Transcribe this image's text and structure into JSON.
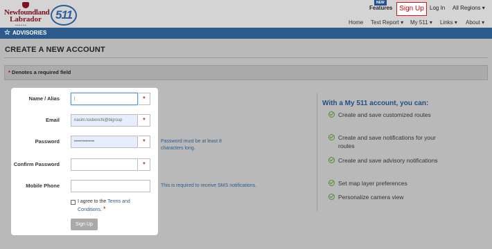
{
  "header": {
    "logo_line1": "Newfoundland",
    "logo_line2": "Labrador",
    "logo_511": "511",
    "new_badge": "NEW",
    "features": "Features",
    "sign_up": "Sign Up",
    "log_in": "Log In",
    "all_regions": "All Regions ▾",
    "nav": [
      "Home",
      "Text Report ▾",
      "My 511 ▾",
      "Links ▾",
      "About ▾"
    ]
  },
  "advisories": "ADVISORIES",
  "page_title": "CREATE A NEW ACCOUNT",
  "required_note": "Denotes a required field",
  "required_marker": "*",
  "form": {
    "alias_label": "Name / Alias",
    "alias_value": "|",
    "email_label": "Email",
    "email_value": "nasim.tosbonchi@bigroup",
    "password_label": "Password",
    "password_value": "••••••••••••••",
    "password_hint": "Password must be at least 8 characters long.",
    "confirm_label": "Confirm Password",
    "confirm_value": "",
    "mobile_label": "Mobile Phone",
    "mobile_value": "",
    "mobile_hint": "This is required to receive SMS notifications.",
    "agree_text": "I agree to the ",
    "terms_link": "Terms and Conditions.",
    "signup_button": "Sign Up"
  },
  "perks": {
    "title": "With a My 511 account, you can:",
    "items": [
      "Create and save customized routes",
      "Create and save notifications for your routes",
      "Create and save advisory notifications",
      "Set map layer preferences",
      "Personalize camera view"
    ]
  },
  "colors": {
    "brand_blue": "#2c5a8c",
    "accent_red": "#cc0000",
    "check_green": "#4d8a2f"
  }
}
